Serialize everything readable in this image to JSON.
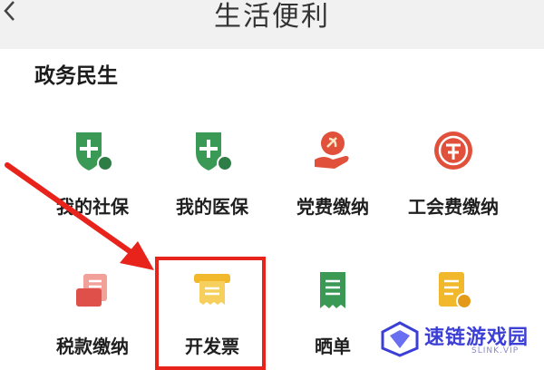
{
  "header": {
    "title": "生活便利",
    "back_icon": "chevron-left-icon"
  },
  "section": {
    "title": "政务民生"
  },
  "items": [
    {
      "label": "我的社保",
      "icon": "social-insurance-shield-icon",
      "color": "#3a9a55"
    },
    {
      "label": "我的医保",
      "icon": "medical-insurance-shield-icon",
      "color": "#3a9a55"
    },
    {
      "label": "党费缴纳",
      "icon": "party-fee-hand-icon",
      "color": "#e0503a"
    },
    {
      "label": "工会费缴纳",
      "icon": "union-fee-emblem-icon",
      "color": "#e0503a"
    },
    {
      "label": "税款缴纳",
      "icon": "tax-payment-icon",
      "color": "#e0504a"
    },
    {
      "label": "开发票",
      "icon": "invoice-printer-icon",
      "color": "#f0b82a"
    },
    {
      "label": "晒单",
      "icon": "receipt-icon",
      "color": "#3a9a55"
    },
    {
      "label": "",
      "icon": "bill-coin-icon",
      "color": "#f0b82a"
    }
  ],
  "annotation": {
    "arrow_color": "#e8231c",
    "box_color": "#e8231c"
  },
  "watermark": {
    "text": "速链游戏园",
    "sub": "SLINK.VIP",
    "color": "#3c3fd6"
  }
}
